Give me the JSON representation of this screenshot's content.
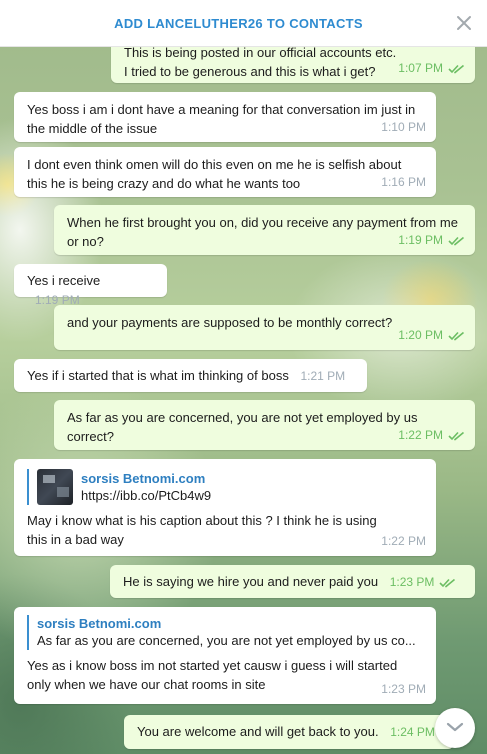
{
  "header": {
    "title": "ADD LANCELUTHER26 TO CONTACTS",
    "close_icon": "close-icon"
  },
  "colors": {
    "accent": "#2e8bd0",
    "outgoing_bubble": "#effdde",
    "incoming_bubble": "#ffffff",
    "read_check": "#6cbe63"
  },
  "messages": [
    {
      "dir": "out",
      "text_line1": "This is being posted in our official accounts etc.",
      "text_line2": "I tried to be generous and this is what i get?",
      "time": "1:07 PM"
    },
    {
      "dir": "in",
      "text": "Yes boss i am i dont have a meaning for that conversation im just in the middle of the issue",
      "time": "1:10 PM"
    },
    {
      "dir": "in",
      "text": "I dont even think omen will do this even on me he is selfish about this he is being crazy and do what he wants too",
      "time": "1:16 PM"
    },
    {
      "dir": "out",
      "text": "When he first brought you on, did you receive any payment from me or no?",
      "time": "1:19 PM"
    },
    {
      "dir": "in",
      "text": "Yes i receive",
      "time": "1:19 PM"
    },
    {
      "dir": "out",
      "text": "and your payments are supposed to be monthly correct?",
      "time": "1:20 PM"
    },
    {
      "dir": "in",
      "text": "Yes if i started that is what im thinking of boss",
      "time": "1:21 PM"
    },
    {
      "dir": "out",
      "text": "As far as you are concerned, you are not yet employed by us correct?",
      "time": "1:22 PM"
    },
    {
      "dir": "in",
      "reply_name": "sorsis Betnomi.com",
      "reply_text": "https://ibb.co/PtCb4w9",
      "text": "May i know what is his caption about this ? I think he is using this in a bad way",
      "time": "1:22 PM"
    },
    {
      "dir": "out",
      "text": "He is saying we hire you and never paid you",
      "time": "1:23 PM"
    },
    {
      "dir": "in",
      "reply_name": "sorsis Betnomi.com",
      "reply_text": "As far as you are concerned, you are not yet employed by us co...",
      "text": "Yes as i know boss im not started yet causw i guess i will started only when we have our chat rooms in site",
      "time": "1:23 PM"
    },
    {
      "dir": "out",
      "text": "You are welcome and will get back to you.",
      "time": "1:24 PM"
    }
  ]
}
